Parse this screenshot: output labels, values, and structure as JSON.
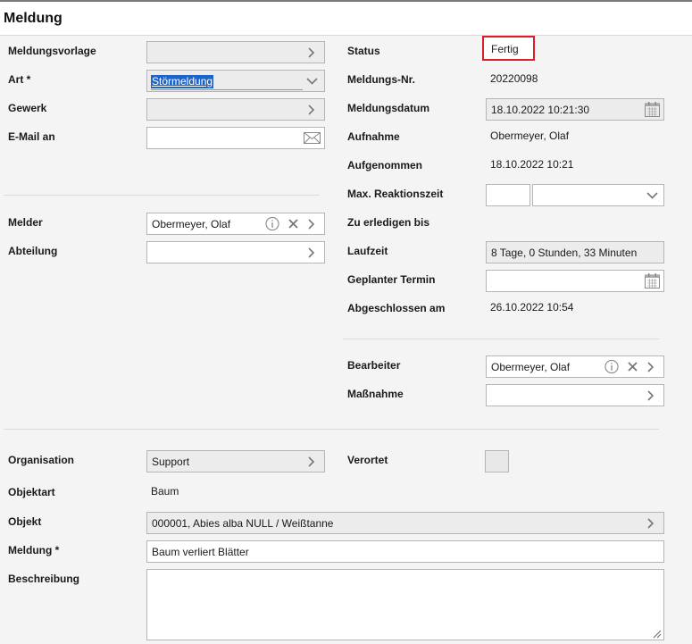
{
  "header": {
    "title": "Meldung"
  },
  "left": {
    "meldungsvorlage": {
      "label": "Meldungsvorlage",
      "value": ""
    },
    "art": {
      "label": "Art *",
      "value": "Störmeldung"
    },
    "gewerk": {
      "label": "Gewerk",
      "value": ""
    },
    "email": {
      "label": "E-Mail an",
      "value": ""
    },
    "melder": {
      "label": "Melder",
      "value": "Obermeyer, Olaf"
    },
    "abteilung": {
      "label": "Abteilung",
      "value": ""
    }
  },
  "right": {
    "status": {
      "label": "Status",
      "value": "Fertig"
    },
    "meldungs_nr": {
      "label": "Meldungs-Nr.",
      "value": "20220098"
    },
    "meldungsdatum": {
      "label": "Meldungsdatum",
      "value": "18.10.2022 10:21:30"
    },
    "aufnahme": {
      "label": "Aufnahme",
      "value": "Obermeyer, Olaf"
    },
    "aufgenommen": {
      "label": "Aufgenommen",
      "value": "18.10.2022 10:21"
    },
    "reaktionszeit": {
      "label": "Max. Reaktionszeit",
      "value": "",
      "unit": ""
    },
    "zu_erledigen": {
      "label": "Zu erledigen bis",
      "value": ""
    },
    "laufzeit": {
      "label": "Laufzeit",
      "value": "8 Tage, 0 Stunden, 33 Minuten"
    },
    "geplanter_termin": {
      "label": "Geplanter Termin",
      "value": ""
    },
    "abgeschlossen": {
      "label": "Abgeschlossen am",
      "value": "26.10.2022 10:54"
    },
    "bearbeiter": {
      "label": "Bearbeiter",
      "value": "Obermeyer, Olaf"
    },
    "massnahme": {
      "label": "Maßnahme",
      "value": ""
    }
  },
  "bottom": {
    "organisation": {
      "label": "Organisation",
      "value": "Support"
    },
    "verortet": {
      "label": "Verortet",
      "checked": false
    },
    "objektart": {
      "label": "Objektart",
      "value": "Baum"
    },
    "objekt": {
      "label": "Objekt",
      "value": "000001, Abies alba NULL / Weißtanne"
    },
    "meldung": {
      "label": "Meldung *",
      "value": "Baum verliert Blätter"
    },
    "beschreibung": {
      "label": "Beschreibung",
      "value": ""
    }
  },
  "colors": {
    "status_highlight": "#d9202a",
    "selection": "#1e64c8"
  },
  "icons": [
    "chevron-right-icon",
    "chevron-down-icon",
    "envelope-icon",
    "info-icon",
    "clear-icon",
    "calendar-icon",
    "resize-grip-icon"
  ]
}
